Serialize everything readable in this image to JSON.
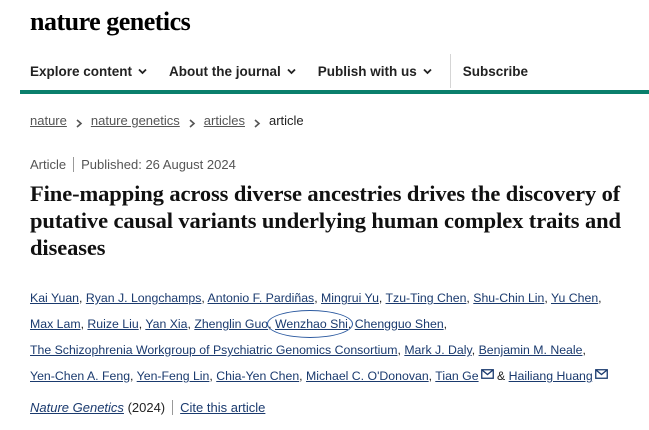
{
  "site": {
    "logo": "nature genetics"
  },
  "nav": {
    "items": [
      {
        "label": "Explore content"
      },
      {
        "label": "About the journal"
      },
      {
        "label": "Publish with us"
      }
    ],
    "subscribe": "Subscribe"
  },
  "breadcrumb": [
    "nature",
    "nature genetics",
    "articles",
    "article"
  ],
  "article": {
    "type": "Article",
    "published": "Published: 26 August 2024",
    "title": "Fine-mapping across diverse ancestries drives the discovery of putative causal variants underlying human complex traits and diseases",
    "authors": [
      "Kai Yuan",
      "Ryan J. Longchamps",
      "Antonio F. Pardiñas",
      "Mingrui Yu",
      "Tzu-Ting Chen",
      "Shu-Chin Lin",
      "Yu Chen",
      "Max Lam",
      "Ruize Liu",
      "Yan Xia",
      "Zhenglin Guo",
      "Wenzhao Shi",
      "Chengguo Shen",
      "The Schizophrenia Workgroup of Psychiatric Genomics Consortium",
      "Mark J. Daly",
      "Benjamin M. Neale",
      "Yen-Chen A. Feng",
      "Yen-Feng Lin",
      "Chia-Yen Chen",
      "Michael C. O'Donovan",
      "Tian Ge",
      "Hailiang Huang"
    ],
    "author_separator": ",",
    "last_separator": "&",
    "journal": "Nature Genetics",
    "year": "(2024)",
    "cite_label": "Cite this article"
  },
  "colors": {
    "accent_rule": "#0a7f6c",
    "link": "#1a3a6e",
    "annotation_circle": "#2c5aa0"
  },
  "icons": {
    "nav": "chevron-down-icon",
    "breadcrumb": "chevron-right-icon",
    "author_contact": "mail-icon"
  }
}
